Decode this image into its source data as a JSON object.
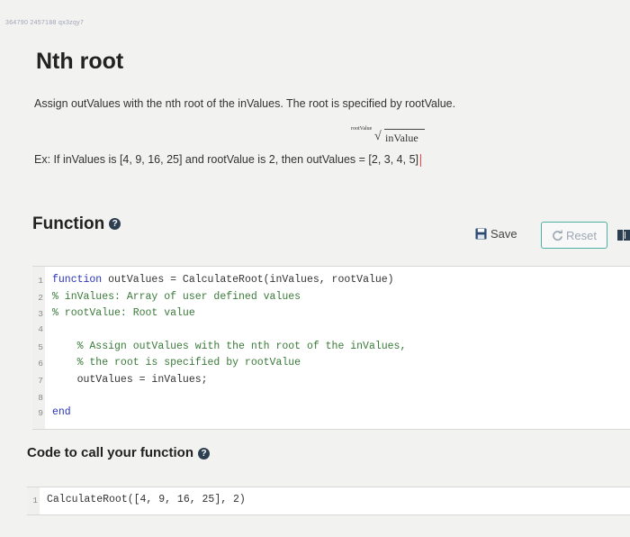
{
  "header": {
    "id_text": "364790 2457188 qx3zqy7"
  },
  "problem": {
    "title": "Nth root",
    "description": "Assign outValues with the nth root of the inValues. The root is specified by rootValue.",
    "formula_index": "rootValue",
    "formula_arg": "inValue",
    "example": "Ex: If inValues is [4, 9, 16, 25] and rootValue is 2, then outValues = [2, 3, 4, 5]"
  },
  "function_section": {
    "heading": "Function",
    "save_label": "Save",
    "reset_label": "Reset",
    "lines": [
      {
        "num": "1",
        "tokens": [
          {
            "t": "function",
            "k": "kw"
          },
          {
            "t": " outValues = CalculateRoot(inValues, rootValue)",
            "k": ""
          }
        ]
      },
      {
        "num": "2",
        "tokens": [
          {
            "t": "% inValues: Array of user defined values",
            "k": "cm"
          }
        ]
      },
      {
        "num": "3",
        "tokens": [
          {
            "t": "% rootValue: Root value",
            "k": "cm"
          }
        ]
      },
      {
        "num": "4",
        "tokens": []
      },
      {
        "num": "5",
        "tokens": [
          {
            "t": "    % Assign outValues with the nth root of the inValues,",
            "k": "cm"
          }
        ]
      },
      {
        "num": "6",
        "tokens": [
          {
            "t": "    % the root is specified by rootValue",
            "k": "cm"
          }
        ]
      },
      {
        "num": "7",
        "tokens": [
          {
            "t": "    outValues = inValues;",
            "k": ""
          }
        ]
      },
      {
        "num": "8",
        "tokens": []
      },
      {
        "num": "9",
        "tokens": [
          {
            "t": "end",
            "k": "kw"
          }
        ]
      }
    ]
  },
  "call_section": {
    "heading": "Code to call your function",
    "lines": [
      {
        "num": "1",
        "text": "CalculateRoot([4, 9, 16, 25], 2)"
      }
    ]
  }
}
